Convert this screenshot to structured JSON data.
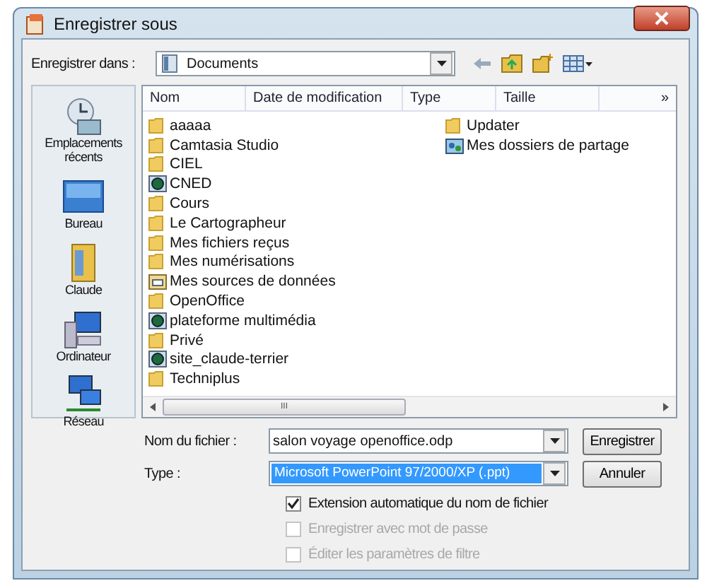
{
  "window": {
    "title": "Enregistrer sous"
  },
  "location": {
    "label": "Enregistrer dans :",
    "value": "Documents"
  },
  "sidebar": {
    "items": [
      {
        "label": "Emplacements récents",
        "kind": "recent"
      },
      {
        "label": "Bureau",
        "kind": "desktop"
      },
      {
        "label": "Claude",
        "kind": "user"
      },
      {
        "label": "Ordinateur",
        "kind": "computer"
      },
      {
        "label": "Réseau",
        "kind": "network"
      }
    ]
  },
  "table": {
    "columns": [
      "Nom",
      "Date de modification",
      "Type",
      "Taille",
      "»"
    ],
    "files": [
      [
        {
          "name": "aaaaa",
          "kind": "folder"
        },
        {
          "name": "Camtasia Studio",
          "kind": "folder"
        },
        {
          "name": "CIEL",
          "kind": "folder"
        },
        {
          "name": "CNED",
          "kind": "web"
        },
        {
          "name": "Cours",
          "kind": "folder"
        },
        {
          "name": "Le Cartographeur",
          "kind": "folder"
        },
        {
          "name": "Mes fichiers reçus",
          "kind": "folder"
        },
        {
          "name": "Mes numérisations",
          "kind": "folder"
        },
        {
          "name": "Mes sources de données",
          "kind": "data"
        },
        {
          "name": "OpenOffice",
          "kind": "folder"
        },
        {
          "name": "plateforme multimédia",
          "kind": "web"
        },
        {
          "name": "Privé",
          "kind": "folder"
        },
        {
          "name": "site_claude-terrier",
          "kind": "web"
        },
        {
          "name": "Techniplus",
          "kind": "folder"
        }
      ],
      [
        {
          "name": "Updater",
          "kind": "folder"
        },
        {
          "name": "Mes dossiers de partage",
          "kind": "shared"
        }
      ]
    ]
  },
  "scrollbar_grip": "III",
  "filename": {
    "label": "Nom du fichier :",
    "value": "salon voyage openoffice.odp"
  },
  "filetype": {
    "label": "Type :",
    "value": "Microsoft PowerPoint 97/2000/XP (.ppt)",
    "selected": true
  },
  "buttons": [
    "Enregistrer",
    "Annuler"
  ],
  "options": [
    {
      "label": "Extension automatique du nom de fichier",
      "checked": true,
      "disabled": false
    },
    {
      "label": "Enregistrer avec mot de passe",
      "checked": false,
      "disabled": true
    },
    {
      "label": "Éditer les paramètres de filtre",
      "checked": false,
      "disabled": true
    }
  ]
}
